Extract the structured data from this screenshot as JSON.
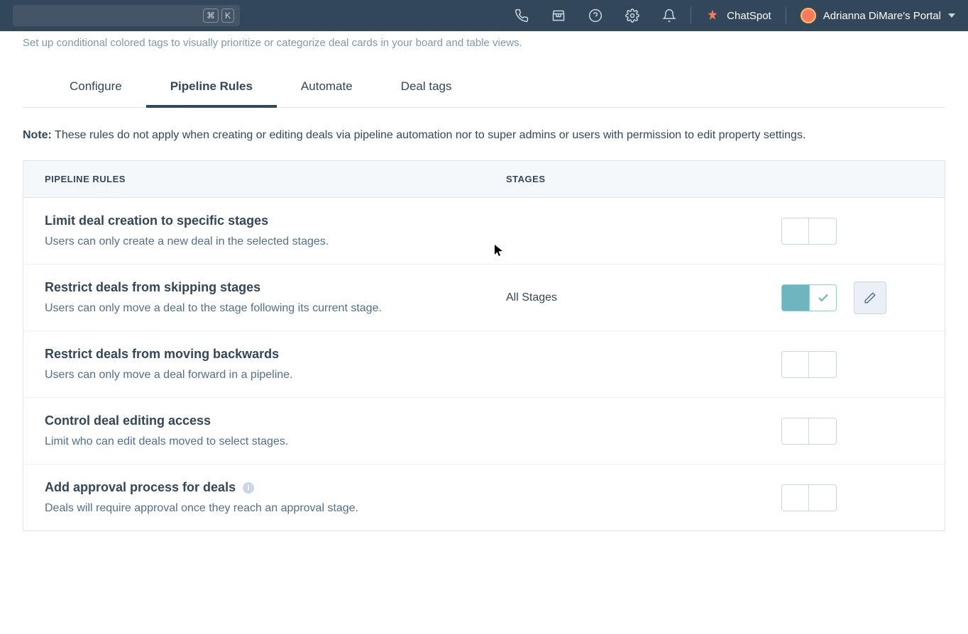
{
  "topnav": {
    "search_kbd1": "⌘",
    "search_kbd2": "K",
    "chatspot_label": "ChatSpot",
    "portal_label": "Adrianna DiMare's Portal"
  },
  "page_description": "Set up conditional colored tags to visually prioritize or categorize deal cards in your board and table views.",
  "tabs": [
    {
      "label": "Configure",
      "active": false
    },
    {
      "label": "Pipeline Rules",
      "active": true
    },
    {
      "label": "Automate",
      "active": false
    },
    {
      "label": "Deal tags",
      "active": false
    }
  ],
  "note_label": "Note:",
  "note_text": " These rules do not apply when creating or editing deals via pipeline automation nor to super admins or users with permission to edit property settings.",
  "table_headers": {
    "rules": "PIPELINE RULES",
    "stages": "STAGES"
  },
  "rules": [
    {
      "title": "Limit deal creation to specific stages",
      "desc": "Users can only create a new deal in the selected stages.",
      "stage": "",
      "on": false,
      "info": false,
      "edit": false
    },
    {
      "title": "Restrict deals from skipping stages",
      "desc": "Users can only move a deal to the stage following its current stage.",
      "stage": "All Stages",
      "on": true,
      "info": false,
      "edit": true
    },
    {
      "title": "Restrict deals from moving backwards",
      "desc": "Users can only move a deal forward in a pipeline.",
      "stage": "",
      "on": false,
      "info": false,
      "edit": false
    },
    {
      "title": "Control deal editing access",
      "desc": "Limit who can edit deals moved to select stages.",
      "stage": "",
      "on": false,
      "info": false,
      "edit": false
    },
    {
      "title": "Add approval process for deals",
      "desc": "Deals will require approval once they reach an approval stage.",
      "stage": "",
      "on": false,
      "info": true,
      "edit": false
    }
  ]
}
